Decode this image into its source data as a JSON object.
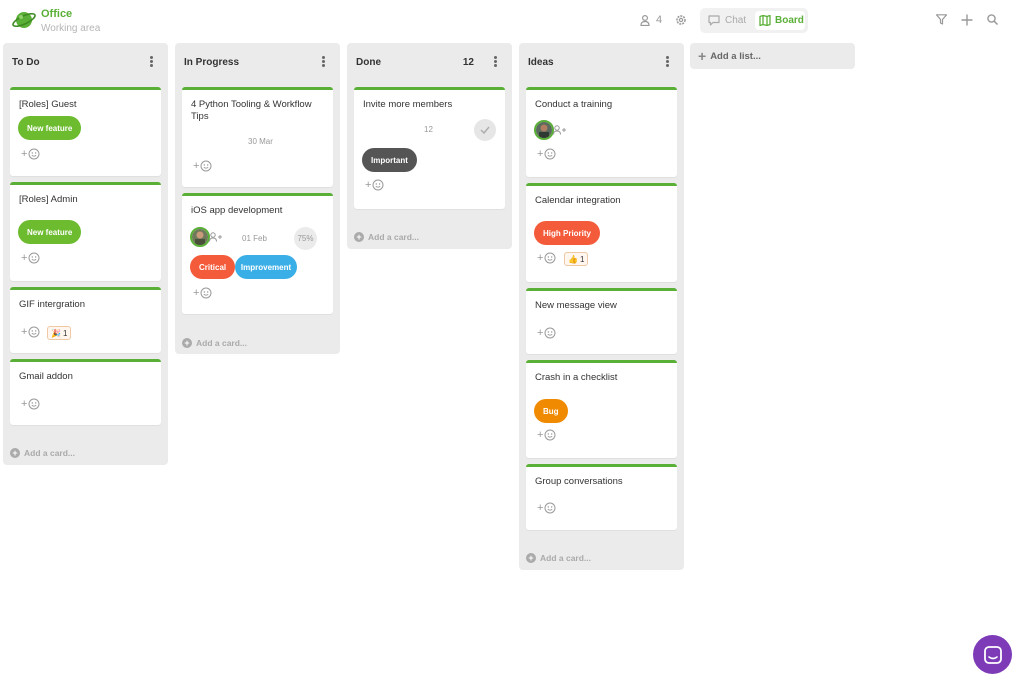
{
  "workspace": {
    "name": "Office",
    "subtitle": "Working area"
  },
  "header": {
    "member_count": "4",
    "view_tabs": [
      {
        "label": "Chat",
        "active": false
      },
      {
        "label": "Board",
        "active": true
      }
    ]
  },
  "colors": {
    "accent": "#5aaf37",
    "new_feature": "#6dbb2f",
    "high_priority": "#f45b3a",
    "critical": "#f45b3a",
    "improvement": "#3aaee6",
    "important": "#555555",
    "bug": "#f08a00",
    "chat_button": "#7d3bb8"
  },
  "lists": [
    {
      "title": "To Do",
      "count": "",
      "cards": [
        {
          "title": "[Roles] Guest",
          "labels": [
            "New feature"
          ]
        },
        {
          "title": "[Roles] Admin",
          "labels": [
            "New feature"
          ]
        },
        {
          "title": "GIF intergration",
          "reaction": {
            "emoji": "🎉",
            "count": "1"
          }
        },
        {
          "title": "Gmail addon"
        }
      ],
      "add_card": "Add a card..."
    },
    {
      "title": "In Progress",
      "count": "",
      "cards": [
        {
          "title": "4 Python Tooling & Workflow Tips",
          "date": "30 Mar"
        },
        {
          "title": "iOS app development",
          "date": "01 Feb",
          "progress": "75%",
          "labels": [
            "Critical",
            "Improvement"
          ]
        }
      ],
      "add_card": "Add a card..."
    },
    {
      "title": "Done",
      "count": "12",
      "cards": [
        {
          "title": "Invite more members",
          "number": "12",
          "labels": [
            "Important"
          ]
        }
      ],
      "add_card": "Add a card..."
    },
    {
      "title": "Ideas",
      "count": "",
      "cards": [
        {
          "title": "Conduct a training"
        },
        {
          "title": "Calendar integration",
          "labels": [
            "High Priority"
          ],
          "reaction": {
            "emoji": "👍",
            "count": "1"
          }
        },
        {
          "title": "New message view"
        },
        {
          "title": "Crash in a checklist",
          "labels": [
            "Bug"
          ]
        },
        {
          "title": "Group conversations"
        }
      ],
      "add_card": "Add a card..."
    }
  ],
  "add_list": "Add a list..."
}
